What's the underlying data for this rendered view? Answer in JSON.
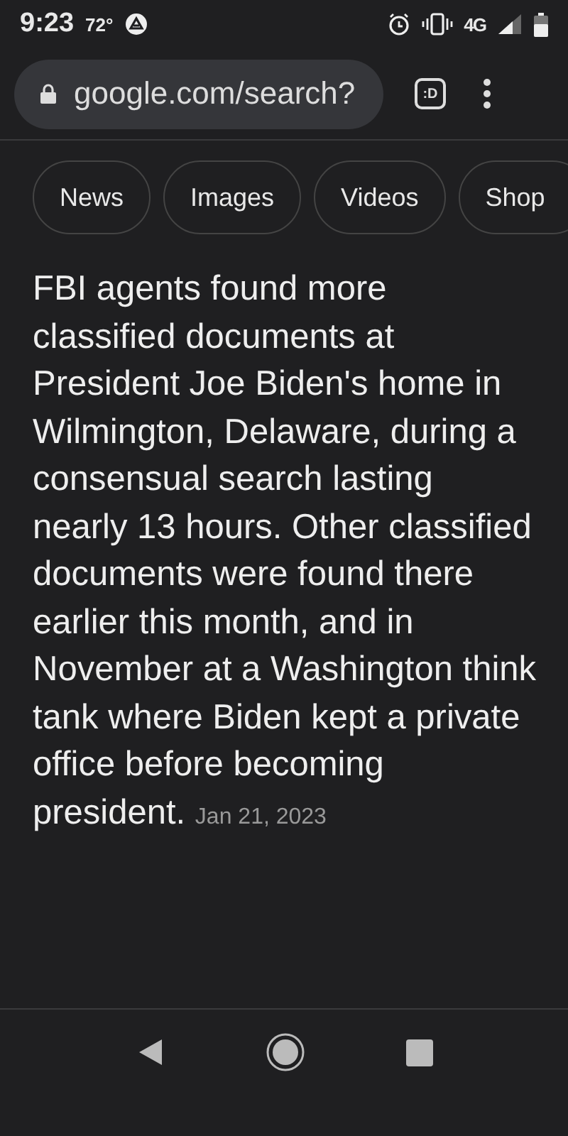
{
  "status_bar": {
    "time": "9:23",
    "temperature": "72°",
    "network": "4G"
  },
  "toolbar": {
    "url": "google.com/search?",
    "tab_count": ":D"
  },
  "chips": [
    {
      "label": "News"
    },
    {
      "label": "Images"
    },
    {
      "label": "Videos"
    },
    {
      "label": "Shop"
    }
  ],
  "snippet": {
    "text": "FBI agents found more classified documents at President Joe Biden's home in Wilmington, Delaware, during a consensual search lasting nearly 13 hours. Other classified documents were found there earlier this month, and in November at a Washington think tank where Biden kept a private office before becoming president.",
    "date": "Jan 21, 2023"
  }
}
